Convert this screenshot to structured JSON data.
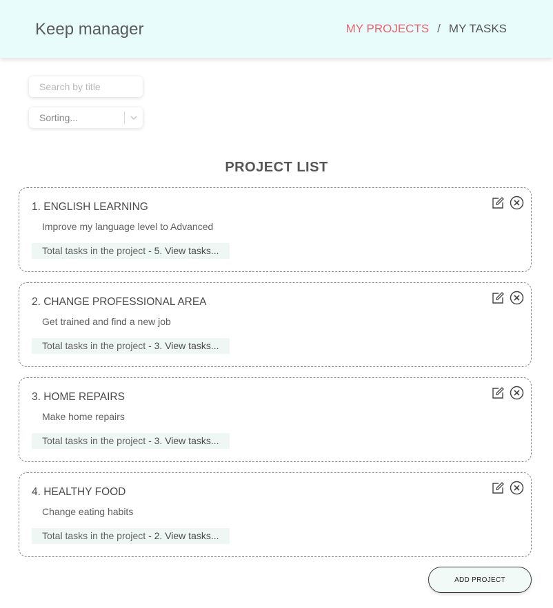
{
  "header": {
    "logo": "Keep manager",
    "nav": {
      "projects": "MY PROJECTS",
      "separator": "/",
      "tasks": "MY TASKS"
    }
  },
  "filters": {
    "search_placeholder": "Search by title",
    "sort_placeholder": "Sorting..."
  },
  "list_title": "PROJECT LIST",
  "projects": [
    {
      "title": "1. ENGLISH LEARNING",
      "description": "Improve my language level to Advanced",
      "count_prefix": "Total tasks in the project ",
      "count_link": "- 5. View tasks..."
    },
    {
      "title": "2. CHANGE PROFESSIONAL AREA",
      "description": "Get trained and find a new job",
      "count_prefix": "Total tasks in the project ",
      "count_link": "- 3. View tasks..."
    },
    {
      "title": "3. HOME REPAIRS",
      "description": "Make home repairs",
      "count_prefix": "Total tasks in the project ",
      "count_link": "- 3. View tasks..."
    },
    {
      "title": "4. HEALTHY FOOD",
      "description": "Change eating habits",
      "count_prefix": "Total tasks in the project ",
      "count_link": "- 2. View tasks..."
    }
  ],
  "add_button": "ADD PROJECT",
  "colors": {
    "header_bg": "#e8fdfb",
    "active_nav": "#e8636c",
    "count_bg": "#eef7f3"
  },
  "icons": {
    "edit": "edit-icon",
    "delete": "close-circle-icon",
    "dropdown": "chevron-down-icon"
  }
}
